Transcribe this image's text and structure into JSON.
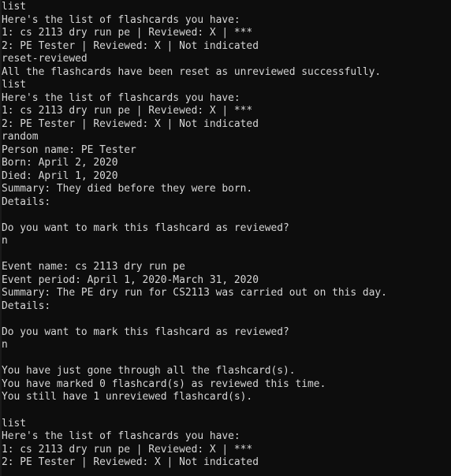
{
  "terminal": {
    "window_kind": "console-output-pane",
    "background_color": "#0d0d0d",
    "foreground_color": "#d6d6d6",
    "columns": 73,
    "rows": 37,
    "lines": [
      "list",
      "Here's the list of flashcards you have:",
      "1: cs 2113 dry run pe | Reviewed: X | ***",
      "2: PE Tester | Reviewed: X | Not indicated",
      "reset-reviewed",
      "All the flashcards have been reset as unreviewed successfully.",
      "list",
      "Here's the list of flashcards you have:",
      "1: cs 2113 dry run pe | Reviewed: X | ***",
      "2: PE Tester | Reviewed: X | Not indicated",
      "random",
      "Person name: PE Tester",
      "Born: April 2, 2020",
      "Died: April 1, 2020",
      "Summary: They died before they were born.",
      "Details:",
      "",
      "Do you want to mark this flashcard as reviewed?",
      "n",
      "",
      "Event name: cs 2113 dry run pe",
      "Event period: April 1, 2020-March 31, 2020",
      "Summary: The PE dry run for CS2113 was carried out on this day.",
      "Details:",
      "",
      "Do you want to mark this flashcard as reviewed?",
      "n",
      "",
      "You have just gone through all the flashcard(s).",
      "You have marked 0 flashcard(s) as reviewed this time.",
      "You still have 1 unreviewed flashcard(s).",
      "",
      "list",
      "Here's the list of flashcards you have:",
      "1: cs 2113 dry run pe | Reviewed: X | ***",
      "2: PE Tester | Reviewed: X | Not indicated"
    ],
    "commands_entered": [
      "list",
      "reset-reviewed",
      "list",
      "random",
      "n",
      "n",
      "list"
    ],
    "flashcards": [
      {
        "index": "1",
        "name": "cs 2113 dry run pe",
        "reviewed": "X",
        "rating": "***"
      },
      {
        "index": "2",
        "name": "PE Tester",
        "reviewed": "X",
        "rating": "Not indicated"
      }
    ],
    "person_card": {
      "name_label": "Person name:",
      "name": "PE Tester",
      "born_label": "Born:",
      "born": "April 2, 2020",
      "died_label": "Died:",
      "died": "April 1, 2020",
      "summary_label": "Summary:",
      "summary": "They died before they were born.",
      "details_label": "Details:",
      "details": ""
    },
    "event_card": {
      "name_label": "Event name:",
      "name": "cs 2113 dry run pe",
      "period_label": "Event period:",
      "period": "April 1, 2020-March 31, 2020",
      "summary_label": "Summary:",
      "summary": "The PE dry run for CS2113 was carried out on this day.",
      "details_label": "Details:",
      "details": ""
    },
    "prompts": {
      "mark_reviewed_question": "Do you want to mark this flashcard as reviewed?",
      "answer_first": "n",
      "answer_second": "n"
    },
    "session_summary": {
      "completed": "You have just gone through all the flashcard(s).",
      "marked_count": "0",
      "marked_line": "You have marked 0 flashcard(s) as reviewed this time.",
      "unreviewed_count": "1",
      "unreviewed_line": "You still have 1 unreviewed flashcard(s)."
    },
    "messages": {
      "list_header": "Here's the list of flashcards you have:",
      "reset_success": "All the flashcards have been reset as unreviewed successfully."
    }
  }
}
